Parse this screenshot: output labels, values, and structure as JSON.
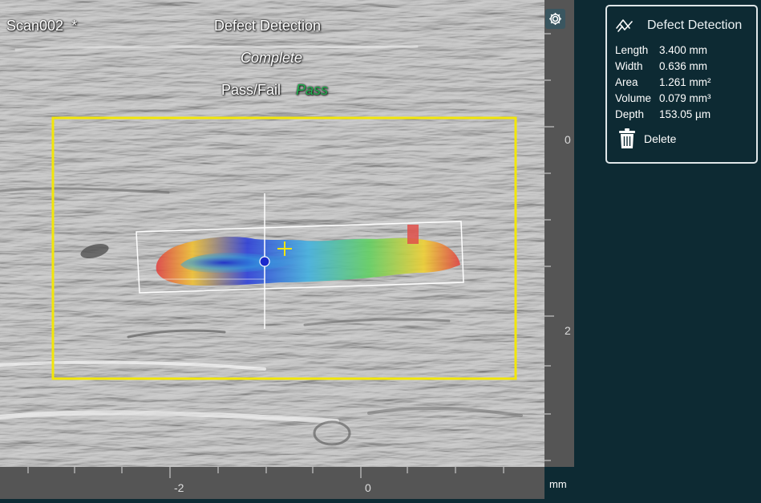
{
  "scan": {
    "name": "Scan002",
    "modified_marker": "*"
  },
  "overlay": {
    "title": "Defect Detection",
    "status": "Complete",
    "passfail_label": "Pass/Fail",
    "passfail_value": "Pass"
  },
  "panel": {
    "title": "Defect Detection",
    "icon": "defect-detection-icon",
    "properties": [
      {
        "label": "Length",
        "value": "3.400 mm"
      },
      {
        "label": "Width",
        "value": "0.636 mm"
      },
      {
        "label": "Area",
        "value": "1.261 mm²"
      },
      {
        "label": "Volume",
        "value": "0.079 mm³"
      },
      {
        "label": "Depth",
        "value": "153.05 µm"
      }
    ],
    "delete_label": "Delete"
  },
  "rulers": {
    "unit": "mm",
    "vertical_labels": [
      "0",
      "2"
    ],
    "horizontal_labels": [
      "-2",
      "0"
    ]
  },
  "colors": {
    "roi": "#f2e60a",
    "pass": "#1fae4c",
    "panel_bg": "#0d2a33"
  }
}
